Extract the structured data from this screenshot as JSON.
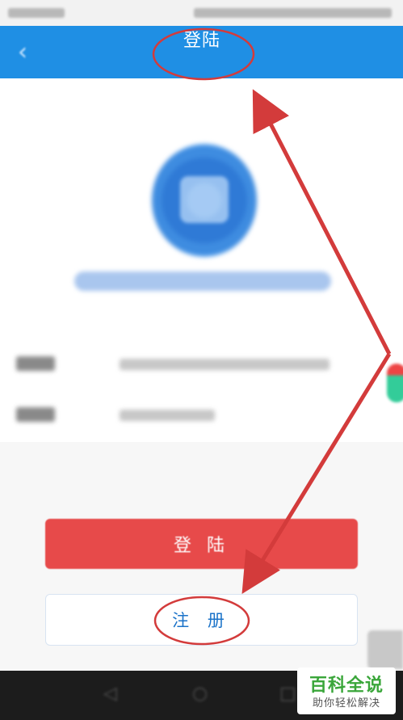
{
  "appbar": {
    "title": "登陆",
    "back_icon": "chevron-left-icon"
  },
  "profile": {
    "avatar": "app-logo-icon"
  },
  "actions": {
    "login_label": "登 陆",
    "register_label": "注 册"
  },
  "colors": {
    "appbar": "#1f8fe4",
    "login_button": "#e74a4a",
    "annotation": "#d33b3b",
    "register_text": "#1b73c9"
  },
  "navigation": {
    "icons": [
      "back-triangle-icon",
      "home-circle-icon",
      "recents-square-icon"
    ]
  },
  "watermark": {
    "title": "百科全说",
    "subtitle": "助你轻松解决"
  }
}
